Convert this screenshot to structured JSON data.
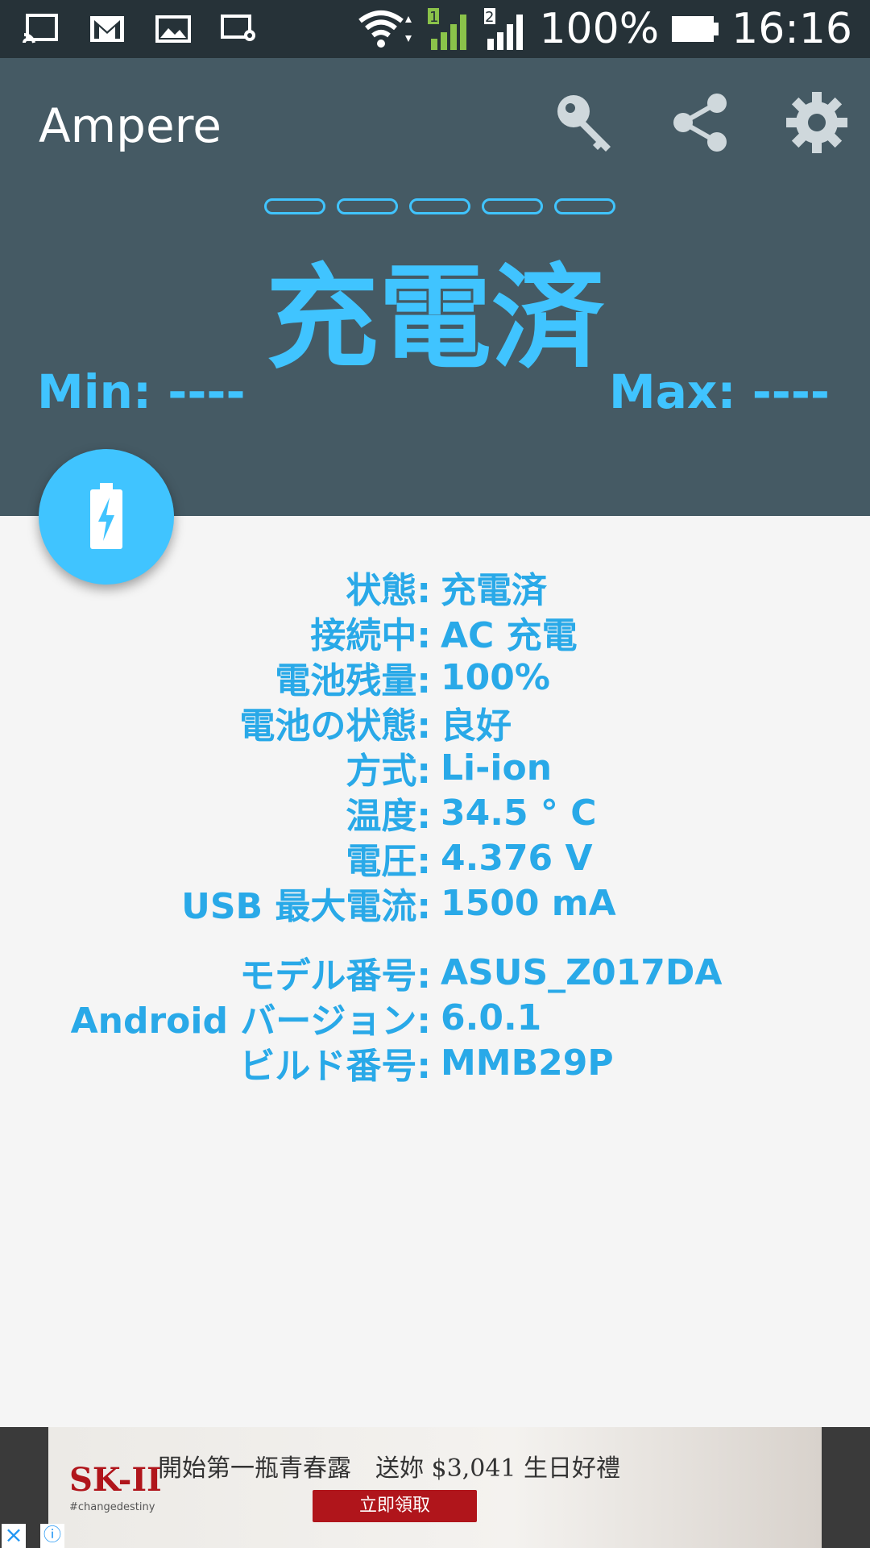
{
  "status_bar": {
    "battery_percent": "100%",
    "time": "16:16",
    "sim1": "1",
    "sim2": "2",
    "icons": [
      "cast-icon",
      "gmail-icon",
      "gallery-icon",
      "screen-settings-icon",
      "wifi-icon",
      "signal-icon",
      "battery-icon"
    ]
  },
  "app": {
    "title": "Ampere",
    "actions": [
      "key-icon",
      "share-icon",
      "settings-icon"
    ]
  },
  "header": {
    "status": "充電済",
    "min_label": "Min: ----",
    "max_label": "Max: ----",
    "accent_color": "#40c4ff",
    "background_color": "#455a64"
  },
  "info": {
    "rows": [
      {
        "key": "状態:",
        "value": "充電済"
      },
      {
        "key": "接続中:",
        "value": "AC 充電"
      },
      {
        "key": "電池残量:",
        "value": "100%"
      },
      {
        "key": "電池の状態:",
        "value": "良好"
      },
      {
        "key": "方式:",
        "value": "Li-ion"
      },
      {
        "key": "温度:",
        "value": "34.5 ° C"
      },
      {
        "key": "電圧:",
        "value": "4.376 V"
      },
      {
        "key": "USB 最大電流:",
        "value": "1500 mA"
      }
    ],
    "device_rows": [
      {
        "key": "モデル番号:",
        "value": "ASUS_Z017DA"
      },
      {
        "key": "Android バージョン:",
        "value": "6.0.1"
      },
      {
        "key": "ビルド番号:",
        "value": "MMB29P"
      }
    ]
  },
  "ad": {
    "brand": "SK-II",
    "tagline": "#changedestiny",
    "headline": "開始第一瓶青春露　送妳 $3,041 生日好禮",
    "cta": "立即領取"
  }
}
